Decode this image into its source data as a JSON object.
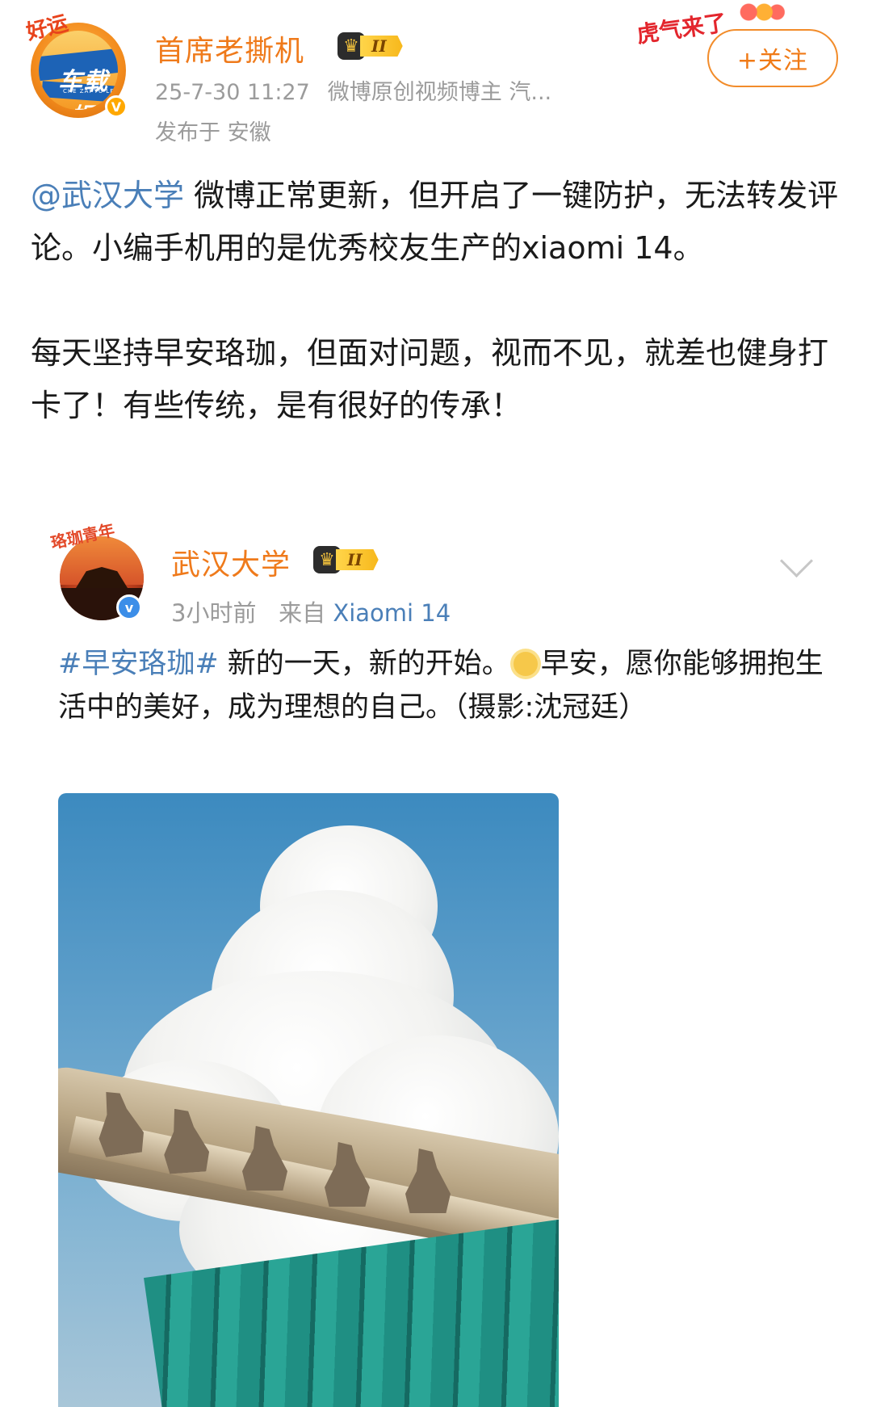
{
  "header": {
    "avatar_tag": "好运",
    "avatar_text_main": "车载",
    "avatar_text_sub": "娱乐",
    "avatar_small": "CHE ZAI YU LE",
    "verified_mark": "V",
    "author_name": "首席老撕机",
    "level_badge": "II",
    "timestamp": "25-7-30 11:27",
    "descriptor": "微博原创视频博主 汽...",
    "location": "发布于 安徽",
    "promo": "虎气来了",
    "follow_label": "+关注"
  },
  "post": {
    "mention": "@武汉大学",
    "paragraph1_rest": " 微博正常更新，但开启了一键防护，无法转发评论。小编手机用的是优秀校友生产的xiaomi 14。",
    "paragraph2": "每天坚持早安珞珈，但面对问题，视而不见，就差也健身打卡了！有些传统，是有很好的传承！"
  },
  "repost": {
    "avatar_tag": "珞珈青年",
    "verified_mark": "v",
    "author_name": "武汉大学",
    "level_badge": "II",
    "time": "3小时前",
    "source_prefix": "来自",
    "source": "Xiaomi 14",
    "hashtag": "#早安珞珈#",
    "text_part1": " 新的一天，新的开始。",
    "text_part2": "早安，愿你能够拥抱生活中的美好，成为理想的自己。（摄影:沈冠廷）",
    "image_subject": "roof-beasts-under-cumulus-cloud"
  },
  "colors": {
    "username": "#ef7a1b",
    "link": "#4a7fb8",
    "meta": "#9b9b9b",
    "follow_border": "#f28c2a"
  }
}
